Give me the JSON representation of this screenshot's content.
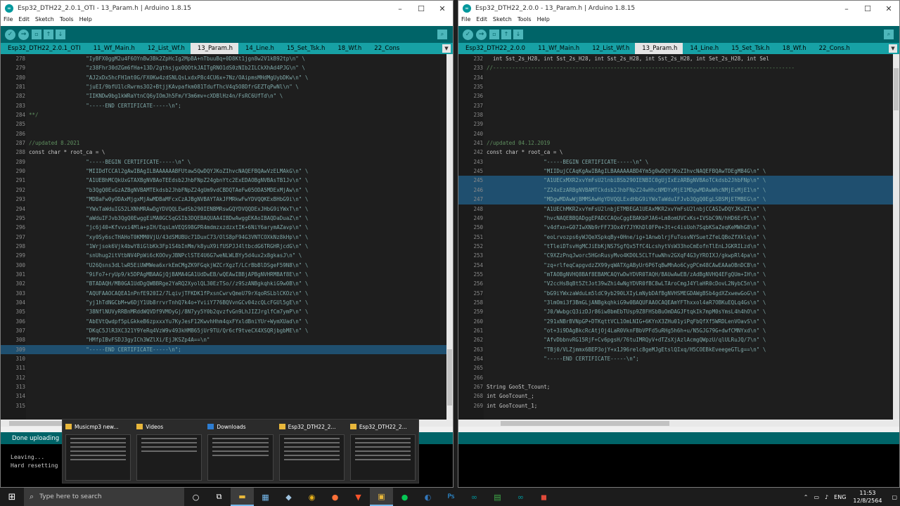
{
  "left": {
    "title": "Esp32_DTH22_2.0.1_OTI - 13_Param.h | Arduino 1.8.15",
    "menu": [
      "File",
      "Edit",
      "Sketch",
      "Tools",
      "Help"
    ],
    "tabs": [
      "Esp32_DTH22_2.0.1_OTI",
      "11_Wf_Main.h",
      "12_List_Wf.h",
      "13_Param.h",
      "14_Line.h",
      "15_Set_Tsk.h",
      "18_Wf.h",
      "22_Cons"
    ],
    "active_tab": 3,
    "lines": [
      {
        "n": "278",
        "t": "                  \"IyBFX0ggM2u4F6OYnBw3Bk2ZpHcIg2MpBA+nTbuuBq+0D8Kt1jgn8w2V1kB92tp\\n\" \\"
      },
      {
        "n": "279",
        "t": "                  \"z38Fhr30dZGm6fHa+13D/2gthsjgx0QOtkJAITgRNO1dS0zNIb2ILCkXhAd4PJG\\n\" \\"
      },
      {
        "n": "280",
        "t": "                  \"AJ2xDx5hcFH1mt0G/FX0Kw4zdSNLQsLxdxP8c4CU6x+7Nz/OAipmsMHdMgUybDKw\\n\" \\"
      },
      {
        "n": "281",
        "t": "                  \"juEI/9bfU1lcRwrms3O2+BtjjKAvpafkm081TdufThcV4q5O8DfrGEZTqPwNl\\n\" \\"
      },
      {
        "n": "282",
        "t": "                  \"IIKNDw9bg1kWRaYtnCQ6yIOmJh5Fm/Y3m6mv+cXDBlHz4n/FsRC6UfTd\\n\" \\"
      },
      {
        "n": "283",
        "t": "                  \"-----END CERTIFICATE-----\\n\";"
      },
      {
        "n": "284",
        "t": "**/"
      },
      {
        "n": "285",
        "t": ""
      },
      {
        "n": "286",
        "t": ""
      },
      {
        "n": "287",
        "t": "//updated 8.2021"
      },
      {
        "n": "288",
        "t": "const char * root_ca = \\"
      },
      {
        "n": "289",
        "t": "                  \"-----BEGIN CERTIFICATE-----\\n\" \\"
      },
      {
        "n": "290",
        "t": "                  \"MIIDdTCCAl2gAwIBAgILBAAAAAABFUtaw5QwDQYJKoZIhvcNAQEFBQAwVzELMAkG\\n\" \\"
      },
      {
        "n": "291",
        "t": "                  \"A1UEBhMCQkUxGTAXBgNVBAoTEEdsb2JhbFNpZ24gbnYtc2ExEDAOBgNVBAsTB1Jv\\n\" \\"
      },
      {
        "n": "292",
        "t": "                  \"b3QgQ0ExGzAZBgNVBAMTEkdsb2JhbFNpZ24gUm9vdCBDQTAeFw05ODA5MDExMjAw\\n\" \\"
      },
      {
        "n": "293",
        "t": "                  \"MDBaFw0yODAxMjgxMjAwMDBaMFcxCzAJBgNVBAYTAkJFMRkwFwYDVQQKExBHbG9i\\n\" \\"
      },
      {
        "n": "294",
        "t": "                  \"YWxTaWduIG52LXNhMRAwDgYDVQQLEwdSb290IENBMRswGQYDVQQDExJHbG9iYWxT\\n\" \\"
      },
      {
        "n": "295",
        "t": "                  \"aWduIFJvb3QgQ0EwggEiMA0GCSqGSIb3DQEBAQUAA4IBDwAwggEKAoIBAQDaDuaZ\\n\" \\"
      },
      {
        "n": "296",
        "t": "                  \"jc6j40+Kfvvxi4Mla+pIH/EqsLmVEQS98GPR4mdmzxzdzxtIK+6NiY6arymAZavp\\n\" \\"
      },
      {
        "n": "297",
        "t": "                  \"xy0Sy6scTHAHoT0KMM0VjU/43dSMUBUc71DuxC73/OlS8pF94G3VNTCOXkNz8kHp\\n\" \\"
      },
      {
        "n": "298",
        "t": "                  \"1Wrjsok6Vjk4bwY8iGlbKk3Fp1S4bInMm/k8yuX9ifUSPJJ4ltbcdG6TRGHRjcdG\\n\" \\"
      },
      {
        "n": "299",
        "t": "                  \"snUhug2itVtbNV4PpWi6cKOOvyJBNPclSTE4U6G7weNLWLBYy5d4ux2x8gkasJ\\n\" \\"
      },
      {
        "n": "300",
        "t": "                  \"U26Qsns3dLlwR5EiUWMWea6xrkEmCMgZK9FGqkjWZCrXgzT/LCrBbBlDSgeF59N8\\n\" \\"
      },
      {
        "n": "301",
        "t": "                  \"9iFo7+ryUp9/k5DPAgMBAAGjQjBAMA4GA1UdDwEB/wQEAwIBBjAPBgNVHRMBAf8E\\n\" \\"
      },
      {
        "n": "302",
        "t": "                  \"BTADAQH/MB0GA1UdDgQWBBRge2YaRQ2XyolQL30EzTSo//z9SzANBgkqhkiG9w0B\\n\" \\"
      },
      {
        "n": "303",
        "t": "                  \"AQUFAAOCAQEA1nPnfE920I2/7LqivjTFKDK1fPxsnCwrvQmeU79rXqoRSLblCKOz\\n\" \\"
      },
      {
        "n": "304",
        "t": "                  \"yj1hTdNGCbM+w6DjY1Ub8rrvrTnhQ7k4o+YviiY776BQVvnGCv04zcQLcFGUl5gE\\n\" \\"
      },
      {
        "n": "305",
        "t": "                  \"38NflNUVyRRBnMRddWQVDf9VMOyGj/8N7yy5Y0b2qvzfvGn9LhJIZJrglfCm7ymP\\n\" \\"
      },
      {
        "n": "306",
        "t": "                  \"AbEVtQwdpf5pLGkkeB6zpxxxYu7KyJesF12KwvhHhm4qxFYxldBniYUr+WymXUad\\n\" \\"
      },
      {
        "n": "307",
        "t": "                  \"DKqC5JlR3XC321Y9YeRq4VzW9v493kHMB65jUr9TU/Qr6cf9tveCX4XSQRjbgbME\\n\" \\"
      },
      {
        "n": "308",
        "t": "                  \"HMfpIBvFSDJ3gyICh3WZlXi/EjJKSZp4A==\\n\""
      },
      {
        "n": "309",
        "t": "                  \"-----END CERTIFICATE-----\\n\";"
      },
      {
        "n": "310",
        "t": ""
      },
      {
        "n": "311",
        "t": ""
      },
      {
        "n": "312",
        "t": ""
      },
      {
        "n": "313",
        "t": ""
      },
      {
        "n": "314",
        "t": ""
      },
      {
        "n": "315",
        "t": ""
      }
    ],
    "highlight_line": "309",
    "status": "Done uploading",
    "console": [
      "Leaving...",
      "Hard resetting"
    ]
  },
  "right": {
    "title": "Esp32_DTH22_2.0.0 - 13_Param.h | Arduino 1.8.15",
    "menu": [
      "File",
      "Edit",
      "Sketch",
      "Tools",
      "Help"
    ],
    "tabs": [
      "Esp32_DTH22_2.0.0",
      "11_Wf_Main.h",
      "12_List_Wf.h",
      "13_Param.h",
      "14_Line.h",
      "15_Set_Tsk.h",
      "18_Wf.h",
      "22_Cons.h"
    ],
    "active_tab": 3,
    "lines": [
      {
        "n": "232",
        "t": "  int Sst_2s_H28, int Sst_2s_H28, int Sst_2s_H28, int Sst_2s_H28, int Set_2s_H28, int Sel"
      },
      {
        "n": "233",
        "t": "//-----------------------------------------------------------------------------------------------"
      },
      {
        "n": "234",
        "t": ""
      },
      {
        "n": "235",
        "t": ""
      },
      {
        "n": "236",
        "t": ""
      },
      {
        "n": "237",
        "t": ""
      },
      {
        "n": "238",
        "t": ""
      },
      {
        "n": "239",
        "t": ""
      },
      {
        "n": "240",
        "t": ""
      },
      {
        "n": "241",
        "t": "//updated 04.12.2019"
      },
      {
        "n": "242",
        "t": "const char * root_ca = \\"
      },
      {
        "n": "243",
        "t": "                  \"-----BEGIN CERTIFICATE-----\\n\" \\"
      },
      {
        "n": "245",
        "t": "                  \"MIIDujCCAqKgAwIBAgILBAAAAAABD4Ym5g0wDQYJKoZIhvcNAQEFBQAwTDEgMB4G\\n\" \\"
      },
      {
        "n": "245",
        "t": "                  \"A1UECxMXR2xvYmFsU2lnbiBSb290IENBIC0gUjIxEzARBgNVBAoTCkdsb2JhbFNp\\n\" \\"
      },
      {
        "n": "246",
        "t": "                  \"Z24xEzARBgNVBAMTCkdsb2JhbFNpZ24wHhcNMDYxMjE1MDgwMDAwWhcNMjExMjE1\\n\" \\"
      },
      {
        "n": "247",
        "t": "                  \"MDgwMDAwWjBMMSAwHgYDVQQLExdHbG9iYWxTaWduIFJvb3QgQ0EgLSBSMjETMBEG\\n\" \\"
      },
      {
        "n": "248",
        "t": "                  \"A1UEChMKR2xvYmFsU2lnbjETMBEGA1UEAxMKR2xvYmFsU2lnbjCCASIwDQYJKoZI\\n\" \\"
      },
      {
        "n": "249",
        "t": "                  \"hvcNAQEBBQADggEPADCCAQoCggEBAKbPJA6+Lm8omUVCxKs+IVSbC9N/hHD6ErPL\\n\" \\"
      },
      {
        "n": "250",
        "t": "                  \"v4dfxn+G07IwXNb9rFF73Ox4Y7JYKhDl0FPe+3t+c4isUoh7SqbKSaZeqKeMWhG8\\n\" \\"
      },
      {
        "n": "251",
        "t": "                  \"eoLrvozps6yWJQeXSpkqBy+0Hne/ig+1AnwblrjFuTosvNYSuetZfeLQBoZfXklq\\n\" \\"
      },
      {
        "n": "252",
        "t": "                  \"tTleiDTsvHgMCJiEbKjNS7SgfQx5TfC4LcshytVsW33hoCmEofnTlEnLJGKRILzd\\n\" \\"
      },
      {
        "n": "253",
        "t": "                  \"C9XZzPnqJworc5HGnRusyMvo4KD0L5CLTfuwNhv2GXqF4G3yYROIXJ/gkwpRl4pa\\n\" \\"
      },
      {
        "n": "254",
        "t": "                  \"zq+rlfeqCapgvdzZX99yqWATXgAByUr6P6TqBwMhAo6CygPCm48CAwEAAaOBnDCB\\n\" \\"
      },
      {
        "n": "255",
        "t": "                  \"mTAOBgNVHQ8BAf8EBAMCAQYwDwYDVR0TAQH/BAUwAwEB/zAdBgNVHQ4EFgQUm+IH\\n\" \\"
      },
      {
        "n": "256",
        "t": "                  \"V2ccHsBqBt5ZtJot39wZhi4wNgYDVR0fBC8wLTAroCmgJ4YlaHR0cDovL2NybC5n\\n\" \\"
      },
      {
        "n": "257",
        "t": "                  \"bG9iYWxzaWduLm5ldC9yb290LXIyLmNybDAfBgNVHSMEGDAWgBSb4gdXZxwewGoG\\n\" \\"
      },
      {
        "n": "258",
        "t": "                  \"3lmOmi3f3BmGLjANBgkqhkiG9w0BAQUFAAOCAQEAmYFThxxol4aR7OBKuEQLq4Gs\\n\" \\"
      },
      {
        "n": "259",
        "t": "                  \"J0/WwbgcQ3izDJr86iw8bmEbTUsp9Z8FHSbBuOmDAGJFtqkIk7mpM0sYmsL4h4hO\\n\" \\"
      },
      {
        "n": "260",
        "t": "                  \"291xNBrBVNpGP+DTKqttVCL1OmLNIG+6KYnX3ZHu01yiPqFbQfXf5WRDLenVOavS\\n\" \\"
      },
      {
        "n": "261",
        "t": "                  \"ot+3i9DAgBkcRcAtjOj4LaR0VknFBbVPFd5uRHg5h6h+u/N5GJG79G+dwfCMNYxd\\n\" \\"
      },
      {
        "n": "262",
        "t": "                  \"AfvDbbnvRG15RjF+Cv6pgsH/76tuIMRQyV+dTZsXjAzlAcmgQWpzU/qlULRuJQ/7\\n\" \\"
      },
      {
        "n": "263",
        "t": "                  \"TBj0/VLZjmmx6BEP3ojY+x1J96relc8geMJgEtslQIxq/H5COEBkEveegeGTLg==\\n\" \\"
      },
      {
        "n": "264",
        "t": "                  \"-----END CERTIFICATE-----\\n\";"
      },
      {
        "n": "265",
        "t": ""
      },
      {
        "n": "266",
        "t": ""
      },
      {
        "n": "267",
        "t": "String GooSt_Tcount;"
      },
      {
        "n": "268",
        "t": "int GooTcount_;"
      },
      {
        "n": "269",
        "t": "int GooTcount_1;"
      }
    ],
    "highlight_lines": [
      "245b",
      "246",
      "247"
    ]
  },
  "thumbnails": [
    {
      "label": "Musicmp3  new..."
    },
    {
      "label": "Videos"
    },
    {
      "label": "Downloads"
    },
    {
      "label": "Esp32_DTH22_2..."
    },
    {
      "label": "Esp32_DTH22_2..."
    }
  ],
  "taskbar": {
    "search_placeholder": "Type here to search",
    "lang": "ENG",
    "time": "11:53",
    "date": "12/8/2564"
  }
}
